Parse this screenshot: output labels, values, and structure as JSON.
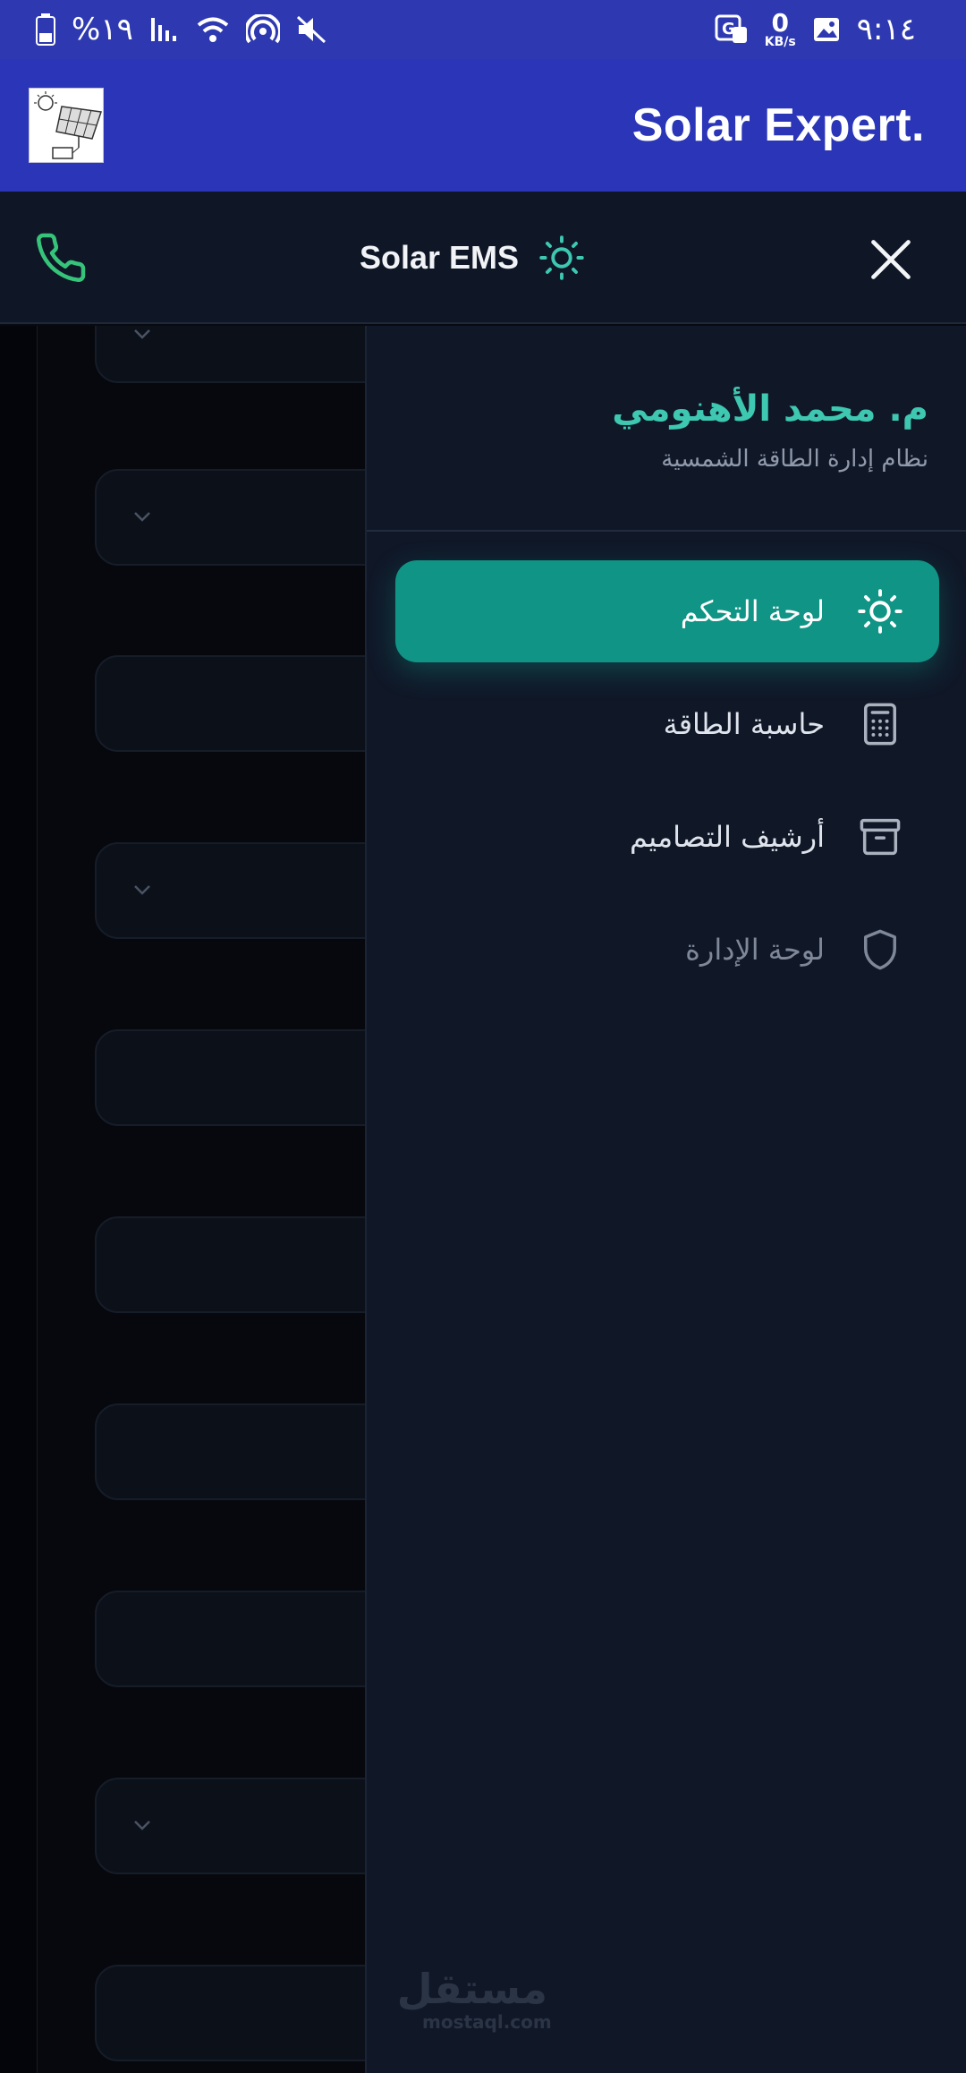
{
  "status_bar": {
    "battery": "%١٩",
    "speed_value": "0",
    "speed_unit": "KB/s",
    "time": "٩:١٤"
  },
  "app_bar": {
    "title": "Solar Expert."
  },
  "header": {
    "brand": "Solar EMS"
  },
  "drawer": {
    "profile": {
      "name": "م. محمد الأهنومي",
      "subtitle": "نظام إدارة الطاقة الشمسية"
    },
    "items": [
      {
        "label": "لوحة التحكم",
        "icon": "sun-icon",
        "active": true
      },
      {
        "label": "حاسبة الطاقة",
        "icon": "calculator-icon",
        "active": false
      },
      {
        "label": "أرشيف التصاميم",
        "icon": "archive-icon",
        "active": false
      },
      {
        "label": "لوحة الإدارة",
        "icon": "shield-icon",
        "active": false
      }
    ]
  },
  "watermark": {
    "arabic": "مستقل",
    "latin": "mostaql.com"
  },
  "colors": {
    "status_bar": "#2e39b1",
    "app_bar": "#2a35b8",
    "header": "#0f1726",
    "drawer": "#101828",
    "accent": "#0f9485",
    "profile_name": "#3ec7b1",
    "phone_icon": "#36c47a"
  }
}
